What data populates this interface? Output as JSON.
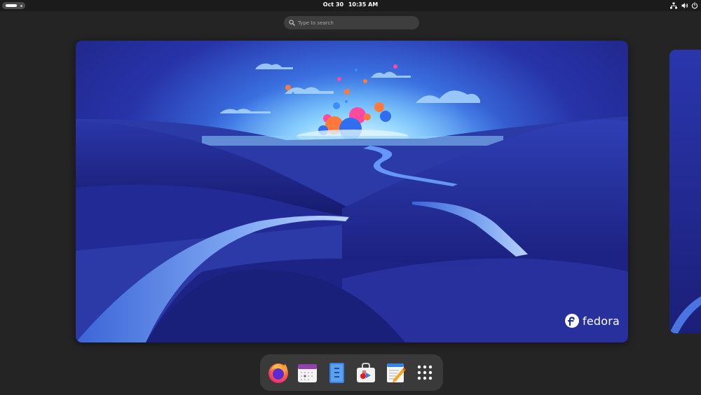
{
  "topbar": {
    "date": "Oct 30",
    "time": "10:35 AM",
    "system_icons": [
      "network-icon",
      "volume-icon",
      "power-icon"
    ]
  },
  "search": {
    "placeholder": "Type to search"
  },
  "workspace": {
    "brand": "fedora"
  },
  "dock": {
    "apps": [
      "firefox-icon",
      "calendar-icon",
      "files-icon",
      "software-icon",
      "text-editor-icon",
      "show-apps-icon"
    ]
  },
  "colors": {
    "panel": "#1b1b1b",
    "overview_bg": "#242424",
    "dock_bg": "#3a3a3a",
    "wallpaper_deep": "#1b1f7a",
    "wallpaper_glow": "#8fd8ff"
  }
}
